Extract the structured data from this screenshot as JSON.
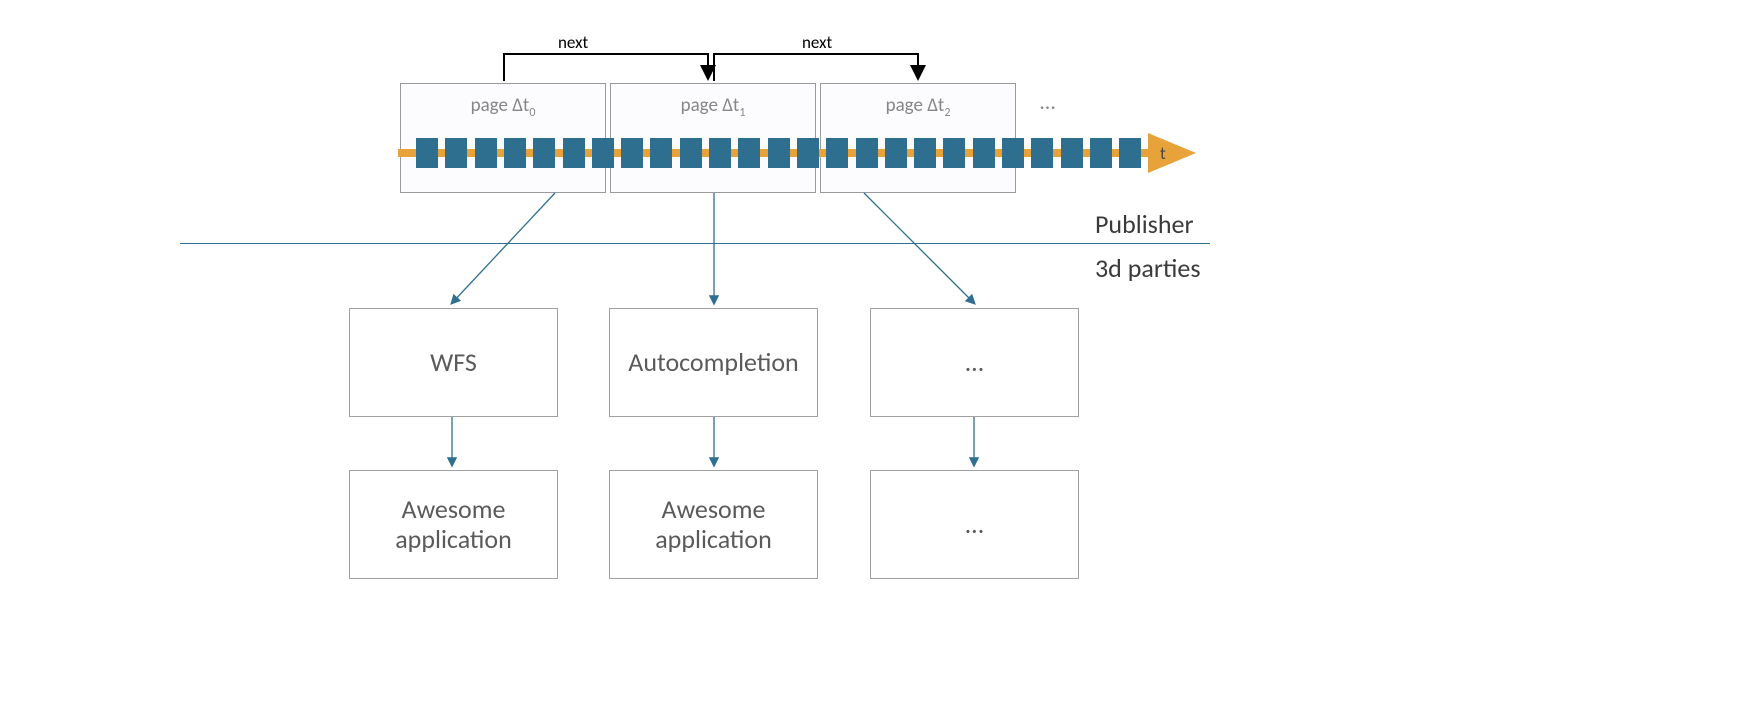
{
  "diagram": {
    "next_labels": [
      "next",
      "next"
    ],
    "pages": [
      "page Δt",
      "page Δt",
      "page Δt"
    ],
    "subs": [
      "0",
      "1",
      "2"
    ],
    "pages_ellipsis": "…",
    "timeline_letter": "t",
    "section_top": "Publisher",
    "section_bottom": "3d parties",
    "row1": [
      "WFS",
      "Autocompletion",
      "…"
    ],
    "row2": [
      "Awesome application",
      "Awesome application",
      "…"
    ]
  }
}
